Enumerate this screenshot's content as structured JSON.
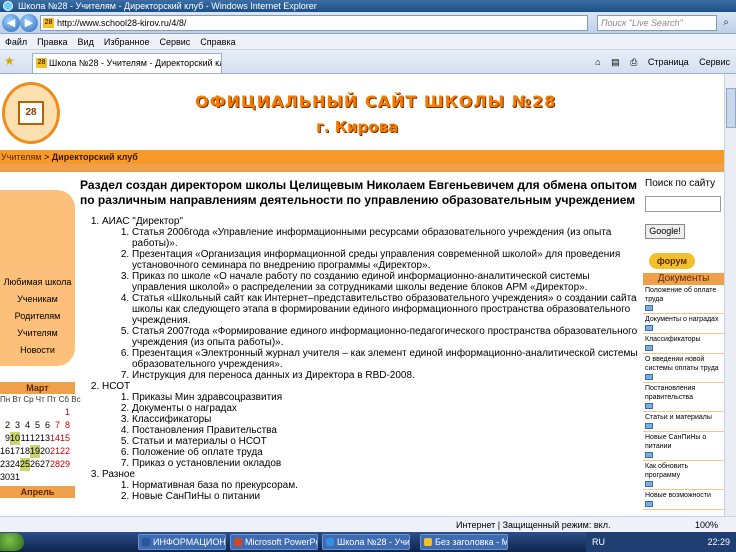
{
  "window": {
    "title": "Школа №28 - Учителям - Директорский клуб - Windows Internet Explorer"
  },
  "address": {
    "url": "http://www.school28-kirov.ru/4/8/",
    "search_placeholder": "Поиск \"Live Search\""
  },
  "menu": [
    "Файл",
    "Правка",
    "Вид",
    "Избранное",
    "Сервис",
    "Справка"
  ],
  "tab": {
    "label": "Школа №28 - Учителям - Директорский клуб"
  },
  "tools": {
    "page": "Страница",
    "service": "Сервис"
  },
  "site": {
    "title_line1": "ОФИЦИАЛЬНЫЙ САЙТ ШКОЛЫ №28",
    "title_line2": "г. Кирова",
    "logo_text": "28"
  },
  "breadcrumb": {
    "parent": "Учителям",
    "separator": " > ",
    "current": "Директорский клуб"
  },
  "left_menu": [
    "Любимая школа",
    "Ученикам",
    "Родителям",
    "Учителям",
    "Новости"
  ],
  "calendar": {
    "month": "Март",
    "weekdays": "Пн Вт Ср Чт Пт Сб Вс",
    "rows": [
      [
        "",
        "",
        "",
        "",
        "",
        "",
        "1"
      ],
      [
        "2",
        "3",
        "4",
        "5",
        "6",
        "7",
        "8"
      ],
      [
        "9",
        "10",
        "11",
        "12",
        "13",
        "14",
        "15"
      ],
      [
        "16",
        "17",
        "18",
        "19",
        "20",
        "21",
        "22"
      ],
      [
        "23",
        "24",
        "25",
        "26",
        "27",
        "28",
        "29"
      ],
      [
        "30",
        "31",
        "",
        "",
        "",
        "",
        ""
      ]
    ],
    "next_month": "Апрель"
  },
  "main": {
    "heading": "Раздел создан директором школы Целищевым Николаем Евгеньевичем для обмена опытом по различным направлениям деятельности по управлению образовательным учреждением",
    "sections": [
      {
        "title": "АИАС \"Директор\"",
        "items": [
          "Статья 2006года «Управление информационными ресурсами образовательного учреждения (из опыта работы)».",
          "Презентация «Организация информационной среды управления современной школой» для проведения установочного семинара по внедрению программы «Директор».",
          "Приказ по школе «О начале работу по созданию единой информационно-аналитической системы управления школой» о распределении за сотрудниками школы ведение блоков АРМ «Директор».",
          "Статья «Школьный сайт как Интернет–представительство образовательного учреждения» о создании сайта школы как следующего этапа в формировании единого информационного пространства образовательного учреждения.",
          "Статья 2007года «Формирование единого информационно-педагогического пространства образовательного учреждения (из опыта работы)».",
          "Презентация «Электронный журнал учителя – как элемент единой информационно-аналитической системы образовательного учреждения».",
          "Инструкция для переноса данных из Директора в RBD-2008."
        ]
      },
      {
        "title": "НСОТ",
        "items": [
          "Приказы Мин здравсоцразвития",
          "Документы о наградах",
          "Классификаторы",
          "Постановления Правительства",
          "Статьи и материалы о НСОТ",
          "Положение об оплате труда",
          "Приказ о установлении окладов"
        ]
      },
      {
        "title": "Разное",
        "items": [
          "Нормативная база по прекурсорам.",
          "Новые СанПиНы о питании"
        ]
      }
    ]
  },
  "right": {
    "search_label": "Поиск по сайту",
    "google_button": "Google!",
    "forum_button": "форум",
    "docs_header": "Документы",
    "docs": [
      "Положение об оплате труда",
      "Документы о наградах",
      "Классификаторы",
      "О введении новой системы оплаты труда",
      "Постановления правительства",
      "Статьи и материалы",
      "Новые СанПиНы о питании",
      "Как обновить программу",
      "Новые возможности"
    ]
  },
  "status": {
    "zone": "Интернет | Защищенный режим: вкл.",
    "zoom": "100%"
  },
  "taskbar": {
    "items": [
      {
        "label": "ИНФОРМАЦИОНН...",
        "color": "#2b579a"
      },
      {
        "label": "Microsoft PowerPoi...",
        "color": "#d24726"
      },
      {
        "label": "Школа №28 - Учит...",
        "color": "#3a8ee6"
      },
      {
        "label": "Без заголовка - Mic...",
        "color": "#f3c02b"
      }
    ],
    "lang": "RU",
    "clock": "22:29"
  }
}
